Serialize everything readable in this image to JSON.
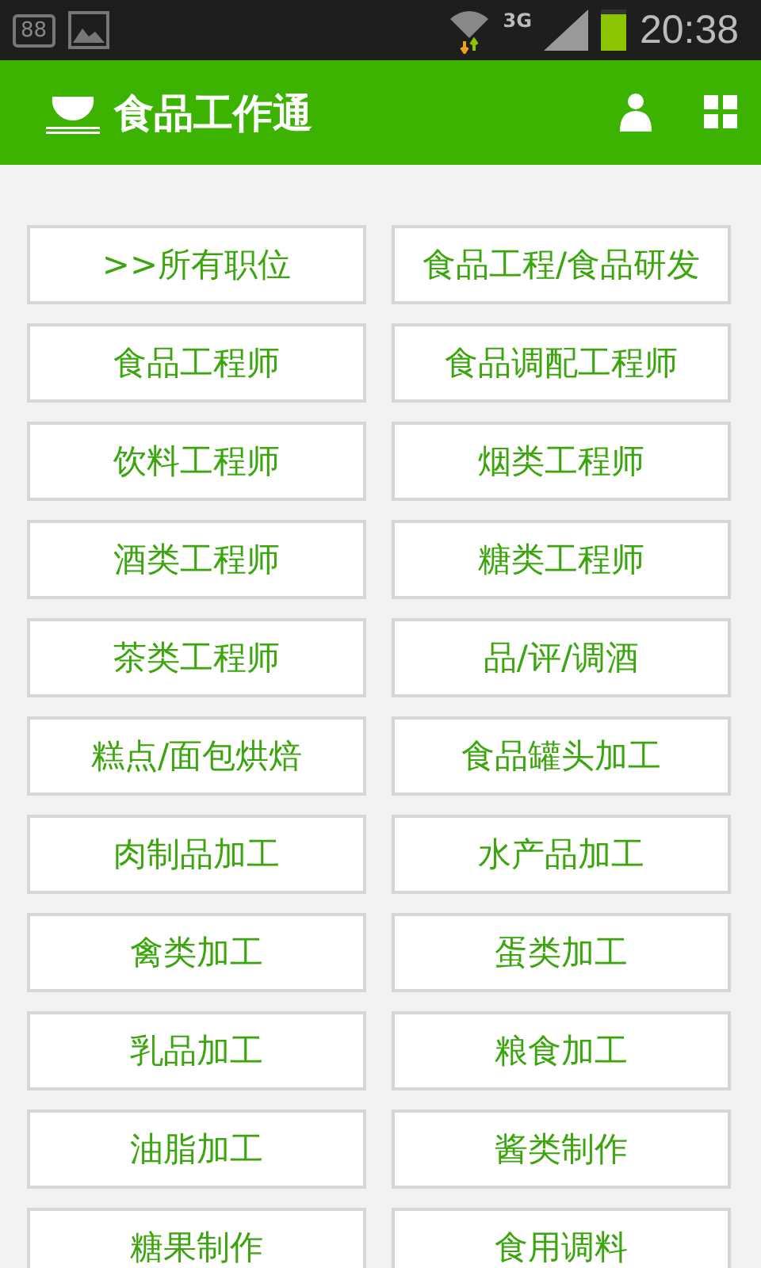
{
  "status_bar": {
    "battery_badge": "88",
    "network": "3G",
    "time": "20:38"
  },
  "header": {
    "title": "食品工作通"
  },
  "categories": [
    {
      "label": ">>所有职位"
    },
    {
      "label": "食品工程/食品研发"
    },
    {
      "label": "食品工程师"
    },
    {
      "label": "食品调配工程师"
    },
    {
      "label": "饮料工程师"
    },
    {
      "label": "烟类工程师"
    },
    {
      "label": "酒类工程师"
    },
    {
      "label": "糖类工程师"
    },
    {
      "label": "茶类工程师"
    },
    {
      "label": "品/评/调酒"
    },
    {
      "label": "糕点/面包烘焙"
    },
    {
      "label": "食品罐头加工"
    },
    {
      "label": "肉制品加工"
    },
    {
      "label": "水产品加工"
    },
    {
      "label": "禽类加工"
    },
    {
      "label": "蛋类加工"
    },
    {
      "label": "乳品加工"
    },
    {
      "label": "粮食加工"
    },
    {
      "label": "油脂加工"
    },
    {
      "label": "酱类制作"
    },
    {
      "label": "糖果制作"
    },
    {
      "label": "食用调料"
    }
  ]
}
